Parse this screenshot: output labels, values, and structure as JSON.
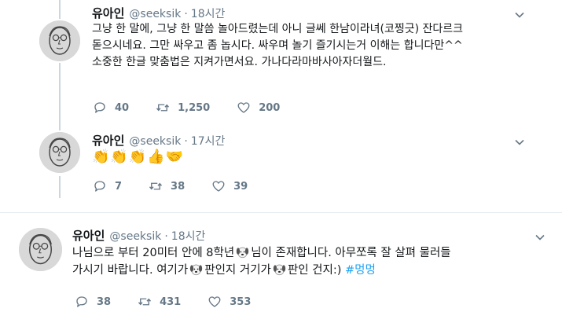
{
  "tweets": [
    {
      "name": "유아인",
      "handle": "@seeksik",
      "sep": "·",
      "time": "18시간",
      "lines": [
        "그냥 한 말에, 그냥 한 말씀 놀아드렸는데 아니 글쎄 한남이라녀(코찡긋) 잔다르크",
        "돋으시네요. 그만 싸우고 좀 놉시다. 싸우며 놀기 즐기시는거 이해는 합니다만^^",
        "소중한 한글 맞춤법은 지켜가면서요. 가나다라마바사아자더월드."
      ],
      "replies": "40",
      "retweets": "1,250",
      "likes": "200"
    },
    {
      "name": "유아인",
      "handle": "@seeksik",
      "sep": "·",
      "time": "17시간",
      "emoji": [
        "👏",
        "👏",
        "👏",
        "👍",
        "🤝"
      ],
      "replies": "7",
      "retweets": "38",
      "likes": "39"
    },
    {
      "name": "유아인",
      "handle": "@seeksik",
      "sep": "·",
      "time": "18시간",
      "line1_a": "나님으로 부터 20미터 안에 8학년",
      "line1_b": "님이 존재합니다. 아무쪼록 잘 살펴 물러들",
      "line2_a": "가시기 바랍니다. 여기가",
      "line2_b": "판인지 거기가",
      "line2_c": "판인 건지:)",
      "hashtag": "#멍멍",
      "replies": "38",
      "retweets": "431",
      "likes": "353"
    }
  ],
  "icons": {
    "reply": "reply-icon",
    "retweet": "retweet-icon",
    "like": "heart-icon",
    "menu": "chevron-down-icon",
    "dog": "dog-face-emoji"
  },
  "colors": {
    "text": "#14171a",
    "secondary": "#657786",
    "link": "#1da1f2",
    "thread_line": "#ccd6dd"
  }
}
